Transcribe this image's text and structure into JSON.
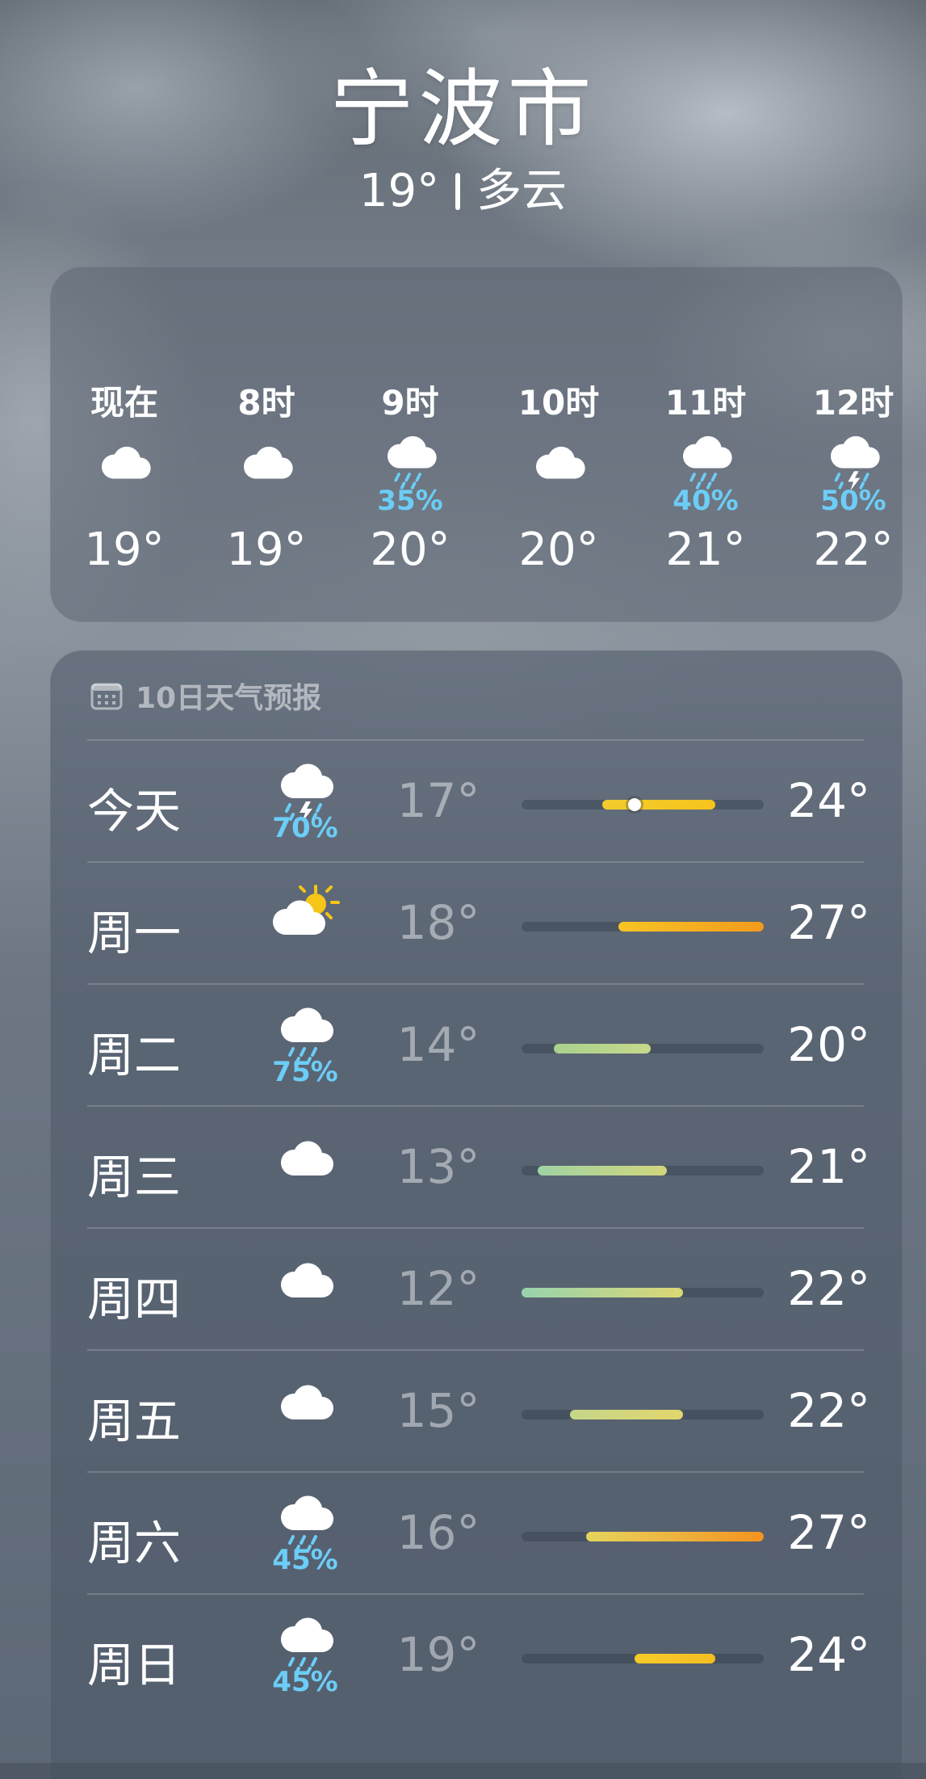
{
  "header": {
    "city": "宁波市",
    "current_temp": "19°",
    "condition": "多云"
  },
  "hourly": [
    {
      "time": "现在",
      "icon": "cloud-icon",
      "pop": "",
      "temp": "19°"
    },
    {
      "time": "8时",
      "icon": "cloud-icon",
      "pop": "",
      "temp": "19°"
    },
    {
      "time": "9时",
      "icon": "cloud-rain-icon",
      "pop": "35%",
      "temp": "20°"
    },
    {
      "time": "10时",
      "icon": "cloud-icon",
      "pop": "",
      "temp": "20°"
    },
    {
      "time": "11时",
      "icon": "cloud-rain-icon",
      "pop": "40%",
      "temp": "21°"
    },
    {
      "time": "12时",
      "icon": "cloud-thunder-rain-icon",
      "pop": "50%",
      "temp": "22°"
    }
  ],
  "daily_forecast": {
    "title": "10日天气预报",
    "icon": "calendar-icon",
    "days": [
      {
        "day": "今天",
        "icon": "cloud-thunder-rain-icon",
        "pop": "70%",
        "low": "17°",
        "high": "24°",
        "low_value": 17,
        "high_value": 24,
        "current": 19,
        "colors": [
          "#f2cd2d",
          "#f6c31c"
        ]
      },
      {
        "day": "周一",
        "icon": "partly-sunny-icon",
        "pop": "",
        "low": "18°",
        "high": "27°",
        "low_value": 18,
        "high_value": 27,
        "colors": [
          "#f7c425",
          "#f39a1d"
        ]
      },
      {
        "day": "周二",
        "icon": "cloud-rain-icon",
        "pop": "75%",
        "low": "14°",
        "high": "20°",
        "low_value": 14,
        "high_value": 20,
        "colors": [
          "#a9d18e",
          "#c6d98a"
        ]
      },
      {
        "day": "周三",
        "icon": "cloud-icon",
        "pop": "",
        "low": "13°",
        "high": "21°",
        "low_value": 13,
        "high_value": 21,
        "colors": [
          "#9fd4a3",
          "#d2d67c"
        ]
      },
      {
        "day": "周四",
        "icon": "cloud-icon",
        "pop": "",
        "low": "12°",
        "high": "22°",
        "low_value": 12,
        "high_value": 22,
        "colors": [
          "#97d3ad",
          "#dcd774"
        ]
      },
      {
        "day": "周五",
        "icon": "cloud-icon",
        "pop": "",
        "low": "15°",
        "high": "22°",
        "low_value": 15,
        "high_value": 22,
        "colors": [
          "#c4d689",
          "#e3d66d"
        ]
      },
      {
        "day": "周六",
        "icon": "cloud-rain-icon",
        "pop": "45%",
        "low": "16°",
        "high": "27°",
        "low_value": 16,
        "high_value": 27,
        "colors": [
          "#e6d45f",
          "#f4931e"
        ]
      },
      {
        "day": "周日",
        "icon": "cloud-rain-icon",
        "pop": "45%",
        "low": "19°",
        "high": "24°",
        "low_value": 19,
        "high_value": 24,
        "colors": [
          "#f6cb2a",
          "#f5bd22"
        ]
      }
    ],
    "scale": {
      "min": 12,
      "max": 27
    }
  },
  "colors": {
    "precip": "#6ccdf6",
    "sun": "#f5c518"
  }
}
